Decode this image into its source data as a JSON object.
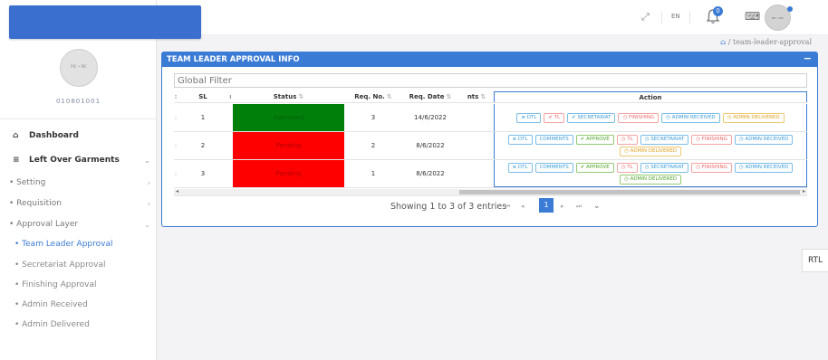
{
  "sidebar": {
    "profile": {
      "avatar_text": "PIC • PIC",
      "id": "010801001"
    },
    "nav": {
      "dashboard": "Dashboard",
      "left_over": "Left Over Garments",
      "setting": "• Setting",
      "requisition": "• Requisition",
      "approval_layer": "• Approval Layer",
      "leaves": [
        "• Team Leader Approval",
        "• Secretariat Approval",
        "• Finishing Approval",
        "• Admin Received",
        "• Admin Delivered"
      ]
    }
  },
  "header": {
    "lang": "EN",
    "notif_count": "0",
    "avatar_text": "PIC • PIC",
    "menu_icon": "hamburger-icon"
  },
  "breadcrumb": {
    "current": "team-leader-approval"
  },
  "panel": {
    "title": "TEAM LEADER APPROVAL INFO",
    "minimize": "−",
    "filter_placeholder": "Global Filter",
    "columns": {
      "sl": "SL",
      "status": "Status",
      "req_no": "Req. No.",
      "req_date": "Req. Date",
      "comments": "nts",
      "action": "Action"
    },
    "rows": [
      {
        "sl": "1",
        "status": "Approved",
        "req_no": "3",
        "date": "14/6/2022",
        "actions": [
          {
            "label": "≡ DTL",
            "c": "blue"
          },
          {
            "label": "✔ TL",
            "c": "red"
          },
          {
            "label": "✔ SECRETARIAT",
            "c": "blue"
          },
          {
            "label": "◷ FINISHING",
            "c": "red"
          },
          {
            "label": "◷ ADMIN RECEIVED",
            "c": "blue"
          },
          {
            "label": "◷ ADMIN DELIVERED",
            "c": "orange"
          }
        ]
      },
      {
        "sl": "2",
        "status": "Pending",
        "req_no": "2",
        "date": "8/6/2022",
        "actions": [
          {
            "label": "≡ DTL",
            "c": "blue"
          },
          {
            "label": "COMMENTS",
            "c": "blue"
          },
          {
            "label": "✔ APPROVE",
            "c": "green"
          },
          {
            "label": "◷ TL",
            "c": "red"
          },
          {
            "label": "◷ SECRETARIAT",
            "c": "blue"
          },
          {
            "label": "◷ FINISHING",
            "c": "red"
          },
          {
            "label": "◷ ADMIN RECEIVED",
            "c": "blue"
          },
          {
            "label": "◷ ADMIN DELIVERED",
            "c": "orange"
          }
        ]
      },
      {
        "sl": "3",
        "status": "Pending",
        "req_no": "1",
        "date": "8/6/2022",
        "actions": [
          {
            "label": "≡ DTL",
            "c": "blue"
          },
          {
            "label": "COMMENTS",
            "c": "blue"
          },
          {
            "label": "✔ APPROVE",
            "c": "green"
          },
          {
            "label": "◷ TL",
            "c": "red"
          },
          {
            "label": "◷ SECRETARIAT",
            "c": "blue"
          },
          {
            "label": "◷ FINISHING",
            "c": "red"
          },
          {
            "label": "◷ ADMIN RECEIVED",
            "c": "blue"
          },
          {
            "label": "◷ ADMIN DELIVERED",
            "c": "green"
          }
        ]
      }
    ],
    "pager": {
      "text": "Showing 1 to 3 of 3 entries",
      "current": "1"
    }
  },
  "rtl_label": "RTL",
  "colors": {
    "primary": "#3a7bd5",
    "approved": "#00800a",
    "pending": "#ff0000"
  }
}
